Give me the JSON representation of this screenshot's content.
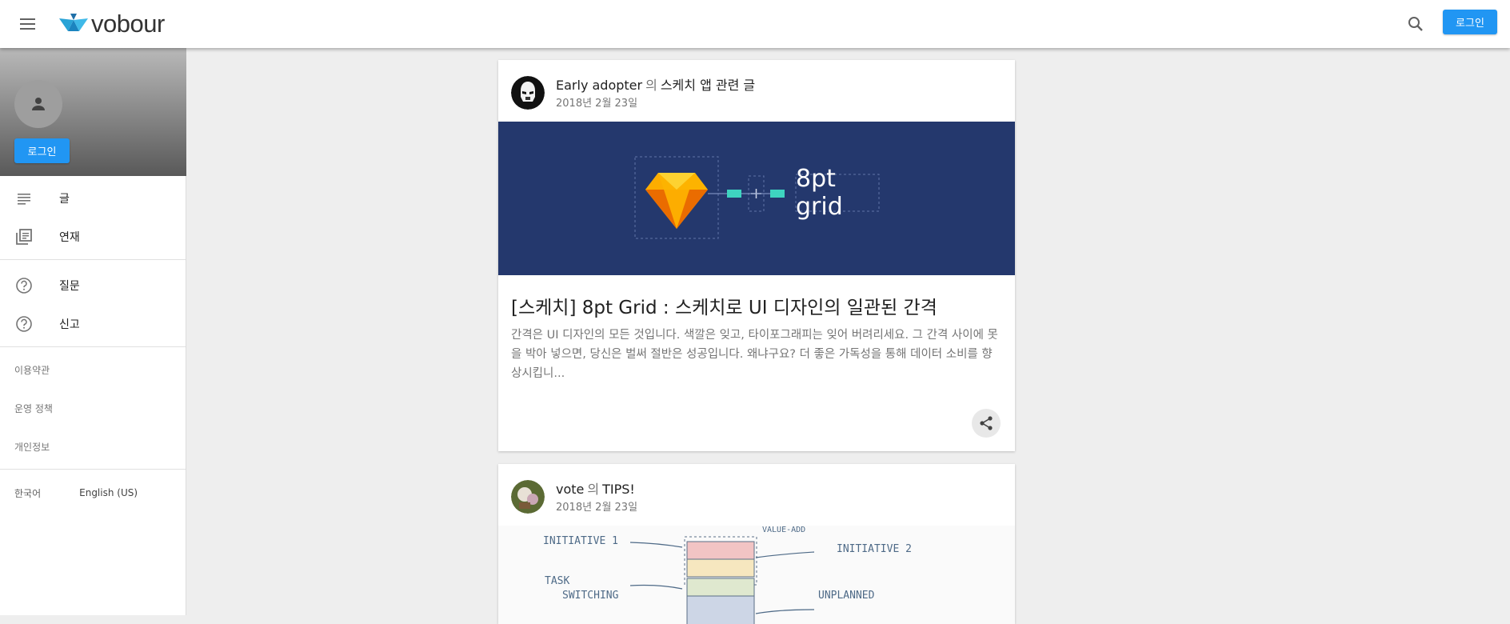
{
  "header": {
    "logo_text": "vobour",
    "login_label": "로그인",
    "menu_icon": "menu-icon",
    "search_icon": "search-icon",
    "accent": "#2196f3"
  },
  "sidebar": {
    "login_label": "로그인",
    "nav": [
      {
        "label": "글",
        "icon": "article-icon"
      },
      {
        "label": "연재",
        "icon": "library-books-icon"
      }
    ],
    "help": [
      {
        "label": "질문",
        "icon": "help-circle-icon"
      },
      {
        "label": "신고",
        "icon": "help-circle-icon"
      }
    ],
    "links": [
      "이용약관",
      "운영 정책",
      "개인정보"
    ],
    "languages": [
      "한국어",
      "English (US)"
    ]
  },
  "feed": [
    {
      "author": "Early adopter",
      "connector": "의",
      "series": "스케치 앱 관련 글",
      "date": "2018년 2월 23일",
      "cover_text": "8pt grid",
      "title": "[스케치] 8pt Grid : 스케치로 UI 디자인의 일관된 간격",
      "excerpt": "간격은 UI 디자인의 모든 것입니다. 색깔은 잊고, 타이포그래피는 잊어 버려리세요. 그 간격 사이에 못을 박아 넣으면, 당신은 벌써 절반은 성공입니다. 왜냐구요? 더 좋은 가독성을 통해 데이터 소비를 향상시킵니...",
      "share_icon": "share-icon"
    },
    {
      "author": "vote",
      "connector": "의",
      "series": "TIPS!",
      "date": "2018년 2월 23일",
      "sketch_labels": [
        "INITIATIVE 1",
        "VALUE-ADD",
        "INITIATIVE 2",
        "TASK",
        "SWITCHING",
        "UNPLANNED"
      ]
    }
  ]
}
